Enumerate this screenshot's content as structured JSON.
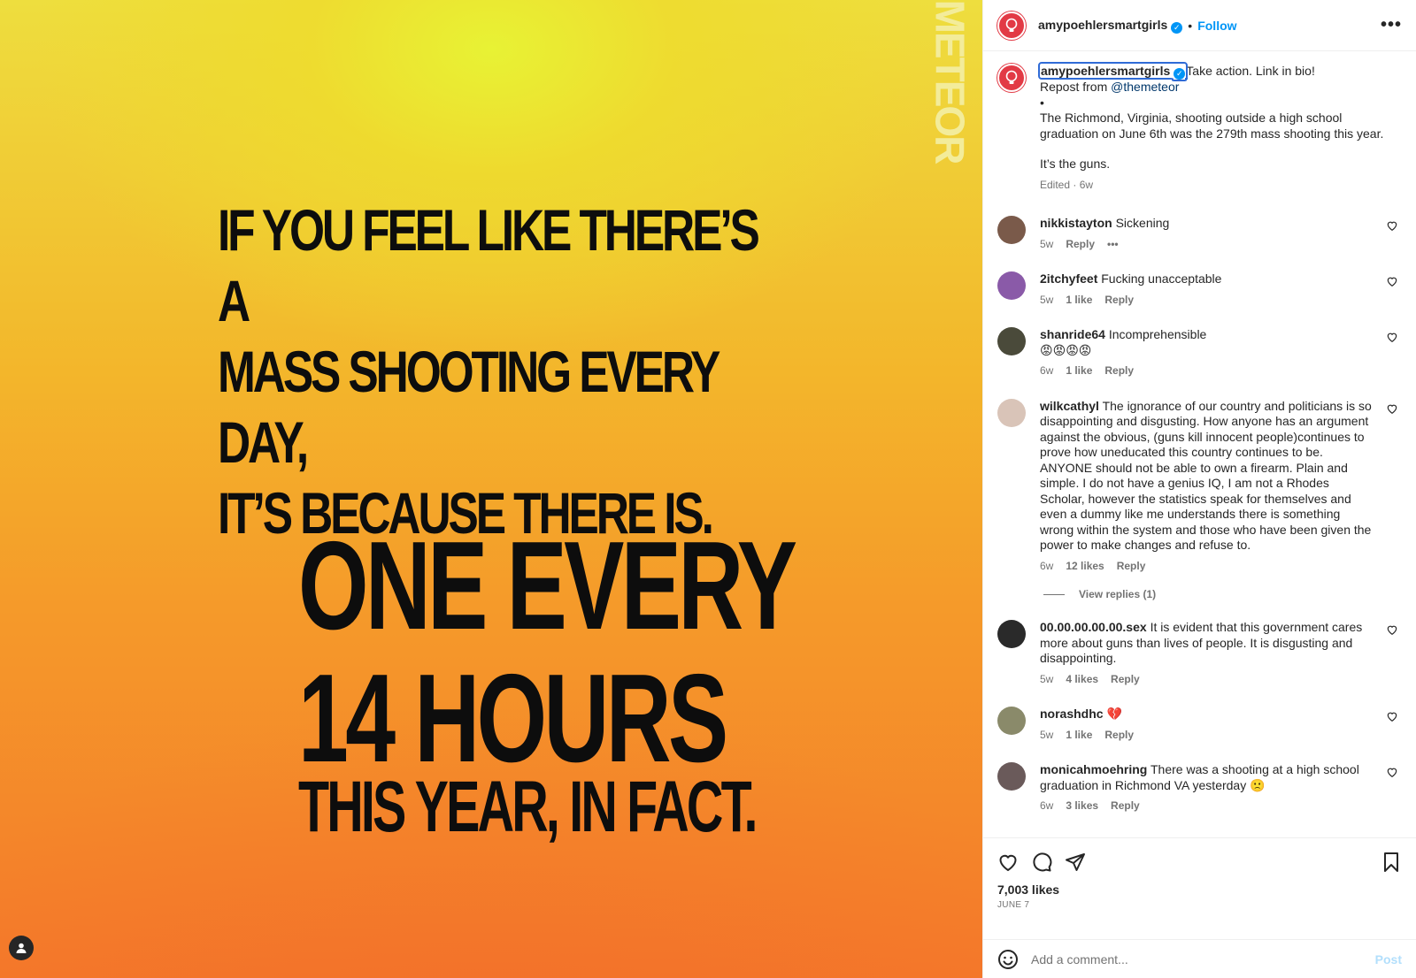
{
  "image": {
    "brand": "METEOR",
    "headline": [
      "IF YOU FEEL LIKE THERE’S A",
      "MASS SHOOTING EVERY DAY,",
      "IT’S BECAUSE THERE IS."
    ],
    "big_line1": "ONE EVERY",
    "big_line2": "14 HOURS",
    "big_line3": "THIS YEAR, IN FACT."
  },
  "header": {
    "username": "amypoehlersmartgirls",
    "separator": "•",
    "follow_label": "Follow",
    "more_label": "•••"
  },
  "caption": {
    "username": "amypoehlersmartgirls",
    "text1": "Take action. Link in bio!",
    "repost_prefix": "Repost from ",
    "repost_mention": "@themeteor",
    "bullet": "•",
    "text2": "The Richmond, Virginia, shooting outside a high school graduation on June 6th was the 279th mass shooting this year.",
    "text3": "It’s the guns.",
    "meta": "Edited · 6w"
  },
  "comments": [
    {
      "user": "nikkistayton",
      "text": "Sickening",
      "time": "5w",
      "likes": "",
      "reply": "Reply",
      "more": "•••",
      "avatar_color": "#7a5a4a"
    },
    {
      "user": "2itchyfeet",
      "text": "Fucking unacceptable",
      "time": "5w",
      "likes": "1 like",
      "reply": "Reply",
      "more": "",
      "avatar_color": "#8a5aa8"
    },
    {
      "user": "shanride64",
      "text": "Incomprehensible",
      "emoji": "😡😡😡😡",
      "time": "6w",
      "likes": "1 like",
      "reply": "Reply",
      "more": "",
      "avatar_color": "#4a4a3a"
    },
    {
      "user": "wilkcathyl",
      "text": "The ignorance of our country and politicians is so disappointing and disgusting. How anyone has an argument against the obvious, (guns kill innocent people)continues to prove how uneducated this country continues to be. ANYONE should not be able to own a firearm. Plain and simple. I do not have a genius IQ, I am not a Rhodes Scholar, however the statistics speak for themselves and even a dummy like me understands there is something wrong within the system and those who have been given the power to make changes and refuse to.",
      "time": "6w",
      "likes": "12 likes",
      "reply": "Reply",
      "more": "",
      "avatar_color": "#d9c4b8"
    },
    {
      "user": "00.00.00.00.00.sex",
      "text": "It is evident that this government cares more about guns than lives of people. It is disgusting and disappointing.",
      "time": "5w",
      "likes": "4 likes",
      "reply": "Reply",
      "more": "",
      "avatar_color": "#2a2a2a"
    },
    {
      "user": "norashdhc",
      "text": "💔",
      "time": "5w",
      "likes": "1 like",
      "reply": "Reply",
      "more": "",
      "avatar_color": "#8a8a6a"
    },
    {
      "user": "monicahmoehring",
      "text": "There was a shooting at a high school graduation in Richmond VA yesterday 🙁",
      "time": "6w",
      "likes": "3 likes",
      "reply": "Reply",
      "more": "",
      "avatar_color": "#6a5a5a"
    }
  ],
  "view_replies": "View replies (1)",
  "stats": {
    "likes": "7,003 likes",
    "date": "JUNE 7"
  },
  "composer": {
    "placeholder": "Add a comment...",
    "post_label": "Post"
  },
  "colors": {
    "accent": "#0095f6",
    "brand_red": "#e23a45"
  }
}
